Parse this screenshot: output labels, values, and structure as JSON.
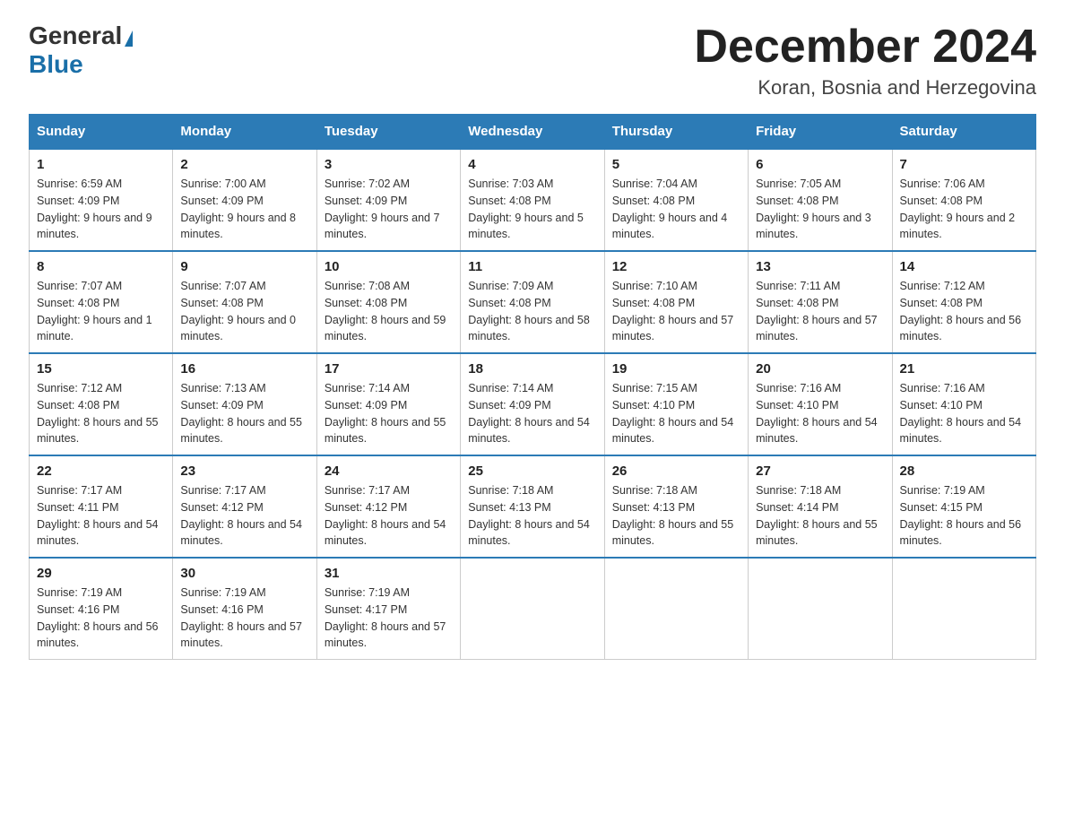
{
  "header": {
    "logo_general": "General",
    "logo_blue": "Blue",
    "title": "December 2024",
    "subtitle": "Koran, Bosnia and Herzegovina"
  },
  "weekdays": [
    "Sunday",
    "Monday",
    "Tuesday",
    "Wednesday",
    "Thursday",
    "Friday",
    "Saturday"
  ],
  "weeks": [
    [
      {
        "day": "1",
        "sunrise": "Sunrise: 6:59 AM",
        "sunset": "Sunset: 4:09 PM",
        "daylight": "Daylight: 9 hours and 9 minutes."
      },
      {
        "day": "2",
        "sunrise": "Sunrise: 7:00 AM",
        "sunset": "Sunset: 4:09 PM",
        "daylight": "Daylight: 9 hours and 8 minutes."
      },
      {
        "day": "3",
        "sunrise": "Sunrise: 7:02 AM",
        "sunset": "Sunset: 4:09 PM",
        "daylight": "Daylight: 9 hours and 7 minutes."
      },
      {
        "day": "4",
        "sunrise": "Sunrise: 7:03 AM",
        "sunset": "Sunset: 4:08 PM",
        "daylight": "Daylight: 9 hours and 5 minutes."
      },
      {
        "day": "5",
        "sunrise": "Sunrise: 7:04 AM",
        "sunset": "Sunset: 4:08 PM",
        "daylight": "Daylight: 9 hours and 4 minutes."
      },
      {
        "day": "6",
        "sunrise": "Sunrise: 7:05 AM",
        "sunset": "Sunset: 4:08 PM",
        "daylight": "Daylight: 9 hours and 3 minutes."
      },
      {
        "day": "7",
        "sunrise": "Sunrise: 7:06 AM",
        "sunset": "Sunset: 4:08 PM",
        "daylight": "Daylight: 9 hours and 2 minutes."
      }
    ],
    [
      {
        "day": "8",
        "sunrise": "Sunrise: 7:07 AM",
        "sunset": "Sunset: 4:08 PM",
        "daylight": "Daylight: 9 hours and 1 minute."
      },
      {
        "day": "9",
        "sunrise": "Sunrise: 7:07 AM",
        "sunset": "Sunset: 4:08 PM",
        "daylight": "Daylight: 9 hours and 0 minutes."
      },
      {
        "day": "10",
        "sunrise": "Sunrise: 7:08 AM",
        "sunset": "Sunset: 4:08 PM",
        "daylight": "Daylight: 8 hours and 59 minutes."
      },
      {
        "day": "11",
        "sunrise": "Sunrise: 7:09 AM",
        "sunset": "Sunset: 4:08 PM",
        "daylight": "Daylight: 8 hours and 58 minutes."
      },
      {
        "day": "12",
        "sunrise": "Sunrise: 7:10 AM",
        "sunset": "Sunset: 4:08 PM",
        "daylight": "Daylight: 8 hours and 57 minutes."
      },
      {
        "day": "13",
        "sunrise": "Sunrise: 7:11 AM",
        "sunset": "Sunset: 4:08 PM",
        "daylight": "Daylight: 8 hours and 57 minutes."
      },
      {
        "day": "14",
        "sunrise": "Sunrise: 7:12 AM",
        "sunset": "Sunset: 4:08 PM",
        "daylight": "Daylight: 8 hours and 56 minutes."
      }
    ],
    [
      {
        "day": "15",
        "sunrise": "Sunrise: 7:12 AM",
        "sunset": "Sunset: 4:08 PM",
        "daylight": "Daylight: 8 hours and 55 minutes."
      },
      {
        "day": "16",
        "sunrise": "Sunrise: 7:13 AM",
        "sunset": "Sunset: 4:09 PM",
        "daylight": "Daylight: 8 hours and 55 minutes."
      },
      {
        "day": "17",
        "sunrise": "Sunrise: 7:14 AM",
        "sunset": "Sunset: 4:09 PM",
        "daylight": "Daylight: 8 hours and 55 minutes."
      },
      {
        "day": "18",
        "sunrise": "Sunrise: 7:14 AM",
        "sunset": "Sunset: 4:09 PM",
        "daylight": "Daylight: 8 hours and 54 minutes."
      },
      {
        "day": "19",
        "sunrise": "Sunrise: 7:15 AM",
        "sunset": "Sunset: 4:10 PM",
        "daylight": "Daylight: 8 hours and 54 minutes."
      },
      {
        "day": "20",
        "sunrise": "Sunrise: 7:16 AM",
        "sunset": "Sunset: 4:10 PM",
        "daylight": "Daylight: 8 hours and 54 minutes."
      },
      {
        "day": "21",
        "sunrise": "Sunrise: 7:16 AM",
        "sunset": "Sunset: 4:10 PM",
        "daylight": "Daylight: 8 hours and 54 minutes."
      }
    ],
    [
      {
        "day": "22",
        "sunrise": "Sunrise: 7:17 AM",
        "sunset": "Sunset: 4:11 PM",
        "daylight": "Daylight: 8 hours and 54 minutes."
      },
      {
        "day": "23",
        "sunrise": "Sunrise: 7:17 AM",
        "sunset": "Sunset: 4:12 PM",
        "daylight": "Daylight: 8 hours and 54 minutes."
      },
      {
        "day": "24",
        "sunrise": "Sunrise: 7:17 AM",
        "sunset": "Sunset: 4:12 PM",
        "daylight": "Daylight: 8 hours and 54 minutes."
      },
      {
        "day": "25",
        "sunrise": "Sunrise: 7:18 AM",
        "sunset": "Sunset: 4:13 PM",
        "daylight": "Daylight: 8 hours and 54 minutes."
      },
      {
        "day": "26",
        "sunrise": "Sunrise: 7:18 AM",
        "sunset": "Sunset: 4:13 PM",
        "daylight": "Daylight: 8 hours and 55 minutes."
      },
      {
        "day": "27",
        "sunrise": "Sunrise: 7:18 AM",
        "sunset": "Sunset: 4:14 PM",
        "daylight": "Daylight: 8 hours and 55 minutes."
      },
      {
        "day": "28",
        "sunrise": "Sunrise: 7:19 AM",
        "sunset": "Sunset: 4:15 PM",
        "daylight": "Daylight: 8 hours and 56 minutes."
      }
    ],
    [
      {
        "day": "29",
        "sunrise": "Sunrise: 7:19 AM",
        "sunset": "Sunset: 4:16 PM",
        "daylight": "Daylight: 8 hours and 56 minutes."
      },
      {
        "day": "30",
        "sunrise": "Sunrise: 7:19 AM",
        "sunset": "Sunset: 4:16 PM",
        "daylight": "Daylight: 8 hours and 57 minutes."
      },
      {
        "day": "31",
        "sunrise": "Sunrise: 7:19 AM",
        "sunset": "Sunset: 4:17 PM",
        "daylight": "Daylight: 8 hours and 57 minutes."
      },
      null,
      null,
      null,
      null
    ]
  ]
}
